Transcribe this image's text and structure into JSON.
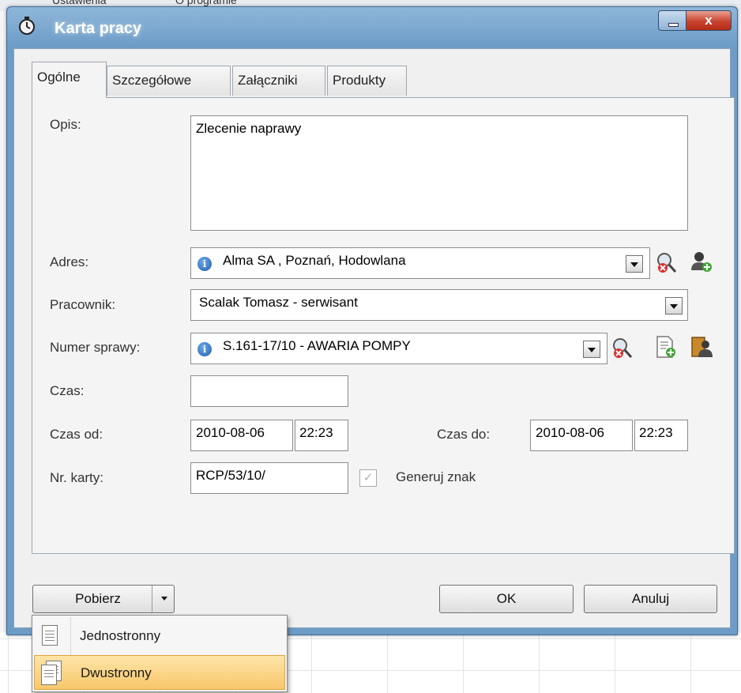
{
  "background": {
    "menu_texts": [
      "Ustawienia",
      "O programie"
    ]
  },
  "window": {
    "title": "Karta pracy",
    "close_glyph": "x"
  },
  "tabs": [
    {
      "label": "Ogólne",
      "active": true
    },
    {
      "label": "Szczegółowe",
      "active": false
    },
    {
      "label": "Załączniki",
      "active": false
    },
    {
      "label": "Produkty",
      "active": false
    }
  ],
  "form": {
    "opis": {
      "label": "Opis:",
      "value": "Zlecenie naprawy"
    },
    "adres": {
      "label": "Adres:",
      "value": "Alma SA , Poznań, Hodowlana"
    },
    "pracownik": {
      "label": "Pracownik:",
      "value": "Scalak Tomasz - serwisant"
    },
    "numer_sprawy": {
      "label": "Numer sprawy:",
      "value": "S.161-17/10 - AWARIA POMPY"
    },
    "czas": {
      "label": "Czas:",
      "value": ""
    },
    "czas_od": {
      "label": "Czas od:",
      "date": "2010-08-06",
      "time": "22:23"
    },
    "czas_do": {
      "label": "Czas do:",
      "date": "2010-08-06",
      "time": "22:23"
    },
    "nr_karty": {
      "label": "Nr. karty:",
      "value": "RCP/53/10/"
    },
    "generuj_znak": {
      "label": "Generuj znak",
      "checked": true,
      "check_glyph": "✓"
    },
    "info_glyph": "i"
  },
  "buttons": {
    "pobierz": "Pobierz",
    "ok": "OK",
    "anuluj": "Anuluj"
  },
  "menu": {
    "items": [
      {
        "label": "Jednostronny",
        "highlighted": false
      },
      {
        "label": "Dwustronny",
        "highlighted": true
      }
    ]
  },
  "colors": {
    "title_bar": "#6b9bc6",
    "menu_highlight": "#f8c76a",
    "close_button": "#c8432e"
  },
  "icons": [
    "search-remove-icon",
    "add-user-icon",
    "add-document-icon",
    "open-case-icon"
  ]
}
